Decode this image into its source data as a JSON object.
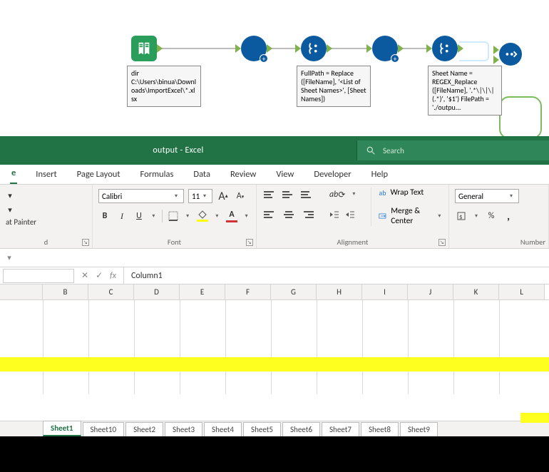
{
  "workflow": {
    "annot_dir": "dir C:\\Users\\binua\\Downloads\\ImportExcel\\*.xlsx",
    "annot_formula1": "FullPath = Replace ([FileName], '<List of Sheet Names>', [Sheet Names])",
    "annot_formula2": "Sheet Name = REGEX_Replace ([FileName], '.*\\|\\|\\|(.*)', '$1') FilePath = './outpu..."
  },
  "excel": {
    "title": "output  -  Excel",
    "search_placeholder": "Search",
    "tabs": {
      "home": "e",
      "insert": "Insert",
      "page_layout": "Page Layout",
      "formulas": "Formulas",
      "data": "Data",
      "review": "Review",
      "view": "View",
      "developer": "Developer",
      "help": "Help"
    },
    "clipboard": {
      "painter": "at Painter",
      "group": "d"
    },
    "font": {
      "name": "Calibri",
      "size": "11",
      "group": "Font"
    },
    "alignment": {
      "wrap": "Wrap Text",
      "merge": "Merge & Center",
      "group": "Alignment"
    },
    "number": {
      "format": "General",
      "group": "Number"
    },
    "formula_value": "Column1",
    "columns": [
      "B",
      "C",
      "D",
      "E",
      "F",
      "G",
      "H",
      "I",
      "J",
      "K",
      "L"
    ],
    "sheets": [
      "Sheet1",
      "Sheet10",
      "Sheet2",
      "Sheet3",
      "Sheet4",
      "Sheet5",
      "Sheet6",
      "Sheet7",
      "Sheet8",
      "Sheet9"
    ]
  }
}
